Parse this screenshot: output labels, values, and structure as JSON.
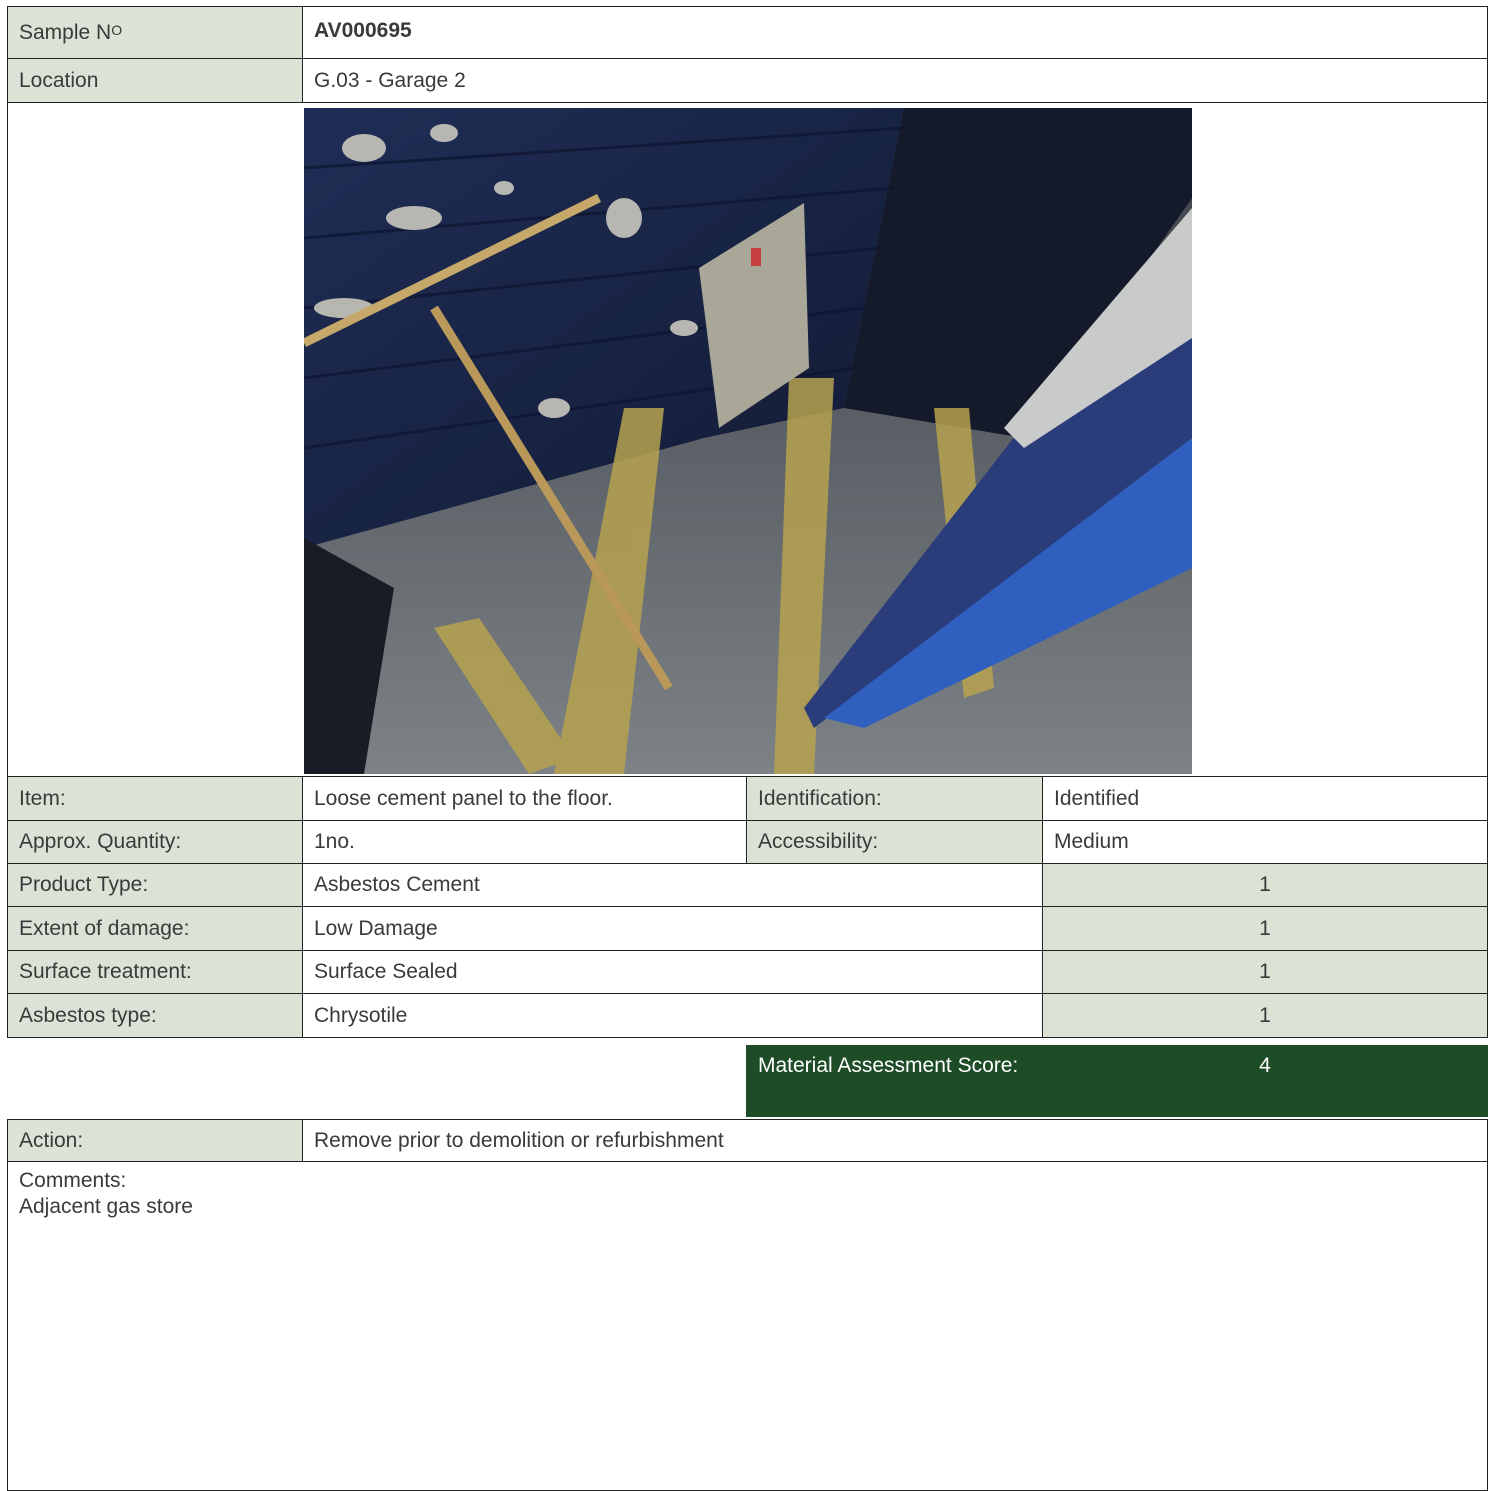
{
  "sample": {
    "label": "Sample N",
    "label_superscript": "O",
    "value": "AV000695"
  },
  "location": {
    "label": "Location",
    "value": "G.03 - Garage 2"
  },
  "photo": {
    "description": "Garage corner with loose cement panel on floor"
  },
  "item": {
    "label": "Item:",
    "value": "Loose cement panel to the floor."
  },
  "identification": {
    "label": "Identification:",
    "value": "Identified"
  },
  "quantity": {
    "label": "Approx. Quantity:",
    "value": "1no."
  },
  "accessibility": {
    "label": "Accessibility:",
    "value": "Medium"
  },
  "assessment": [
    {
      "label": "Product Type:",
      "value": "Asbestos Cement",
      "score": "1"
    },
    {
      "label": "Extent of damage:",
      "value": "Low Damage",
      "score": "1"
    },
    {
      "label": "Surface treatment:",
      "value": "Surface Sealed",
      "score": "1"
    },
    {
      "label": "Asbestos type:",
      "value": "Chrysotile",
      "score": "1"
    }
  ],
  "material_score": {
    "label": "Material Assessment Score:",
    "value": "4"
  },
  "action": {
    "label": "Action:",
    "value": "Remove prior to demolition or refurbishment"
  },
  "comments": {
    "label": "Comments:",
    "value": "Adjacent gas store"
  },
  "colors": {
    "label_bg": "#dbe3d6",
    "score_bg": "#1d4c27"
  }
}
